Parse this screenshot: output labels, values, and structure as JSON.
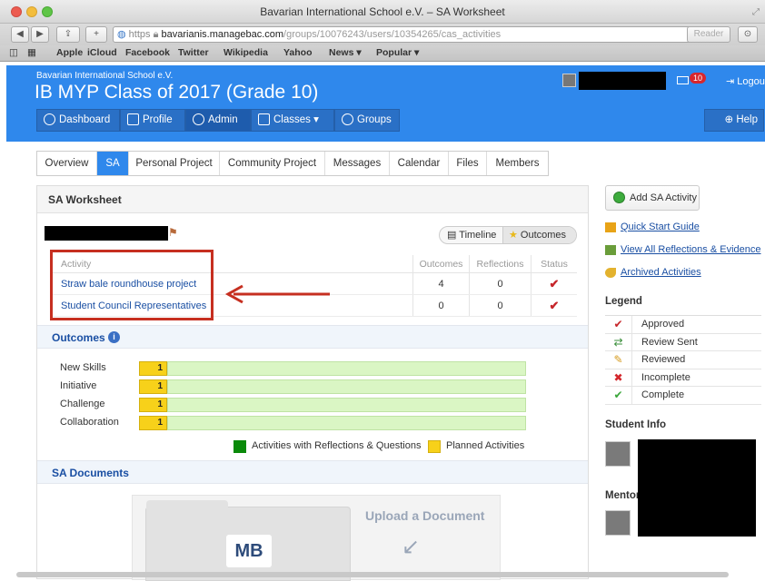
{
  "browser": {
    "window_title": "Bavarian International School e.V. – SA Worksheet",
    "url_scheme": "https",
    "url_host": "bavarianis.managebac.com",
    "url_path": "/groups/10076243/users/10354265/cas_activities",
    "reader_label": "Reader",
    "bookmarks": [
      "Apple",
      "iCloud",
      "Facebook",
      "Twitter",
      "Wikipedia",
      "Yahoo",
      "News ▾",
      "Popular ▾"
    ]
  },
  "header": {
    "school": "Bavarian International School e.V.",
    "class_title": "IB MYP Class of 2017 (Grade 10)",
    "notification_count": "10",
    "logout_label": "Logout",
    "help_label": "Help",
    "nav": [
      {
        "label": "Dashboard"
      },
      {
        "label": "Profile"
      },
      {
        "label": "Admin"
      },
      {
        "label": "Classes ▾"
      },
      {
        "label": "Groups"
      }
    ]
  },
  "tabs": [
    {
      "label": "Overview"
    },
    {
      "label": "SA"
    },
    {
      "label": "Personal Project"
    },
    {
      "label": "Community Project"
    },
    {
      "label": "Messages"
    },
    {
      "label": "Calendar"
    },
    {
      "label": "Files"
    },
    {
      "label": "Members"
    }
  ],
  "worksheet": {
    "title": "SA Worksheet",
    "view_toggle": {
      "timeline": "Timeline",
      "outcomes": "Outcomes"
    },
    "columns": {
      "activity": "Activity",
      "outcomes": "Outcomes",
      "reflections": "Reflections",
      "status": "Status"
    },
    "activities": [
      {
        "name": "Straw bale roundhouse project",
        "outcomes": "4",
        "reflections": "0",
        "status": "✔"
      },
      {
        "name": "Student Council Representatives",
        "outcomes": "0",
        "reflections": "0",
        "status": "✔"
      }
    ]
  },
  "outcomes": {
    "title": "Outcomes",
    "info_icon": "i",
    "rows": [
      {
        "label": "New Skills",
        "planned": "1"
      },
      {
        "label": "Initiative",
        "planned": "1"
      },
      {
        "label": "Challenge",
        "planned": "1"
      },
      {
        "label": "Collaboration",
        "planned": "1"
      }
    ],
    "legend_green": "Activities with Reflections & Questions",
    "legend_yellow": "Planned Activities",
    "colors": {
      "green": "#0a8a0a",
      "yellow": "#f7d11a"
    }
  },
  "documents": {
    "title": "SA Documents",
    "upload_label": "Upload a Document",
    "logo": "MB"
  },
  "sidebar": {
    "add_activity": "Add SA Activity",
    "links": [
      "Quick Start Guide",
      "View All Reflections & Evidence",
      "Archived Activities"
    ],
    "legend_title": "Legend",
    "legend": [
      {
        "icon": "check-icon",
        "glyph": "✔",
        "label": "Approved"
      },
      {
        "icon": "review-sent-icon",
        "glyph": "⇄",
        "label": "Review Sent"
      },
      {
        "icon": "reviewed-icon",
        "glyph": "✎",
        "label": "Reviewed"
      },
      {
        "icon": "incomplete-icon",
        "glyph": "✖",
        "label": "Incomplete"
      },
      {
        "icon": "complete-icon",
        "glyph": "✔",
        "label": "Complete"
      }
    ],
    "student_info_title": "Student Info",
    "mentor_title": "Mentor"
  }
}
